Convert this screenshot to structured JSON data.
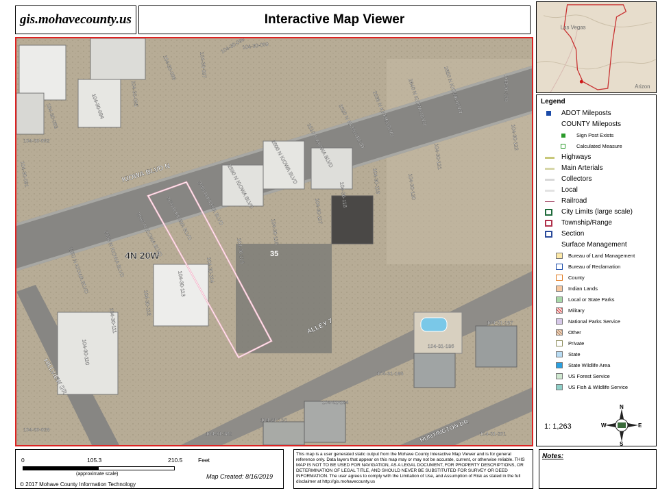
{
  "brand": "gis.mohavecounty.us",
  "title": "Interactive Map Viewer",
  "locator": {
    "labels": [
      "Las Vegas",
      "Arizon"
    ]
  },
  "legend": {
    "title": "Legend",
    "items": [
      {
        "label": "ADOT Mileposts",
        "kind": "sq",
        "color": "#1a4aa8"
      },
      {
        "label": "COUNTY Mileposts",
        "kind": "none"
      },
      {
        "label": "Sign Post Exists",
        "kind": "dot",
        "color": "#2a9a2a",
        "small": true
      },
      {
        "label": "Calculated Measure",
        "kind": "ring",
        "color": "#2a9a2a",
        "small": true
      },
      {
        "label": "Highways",
        "kind": "line",
        "color": "#c8c87a"
      },
      {
        "label": "Main Arterials",
        "kind": "line",
        "color": "#d6d6a8"
      },
      {
        "label": "Collectors",
        "kind": "line",
        "color": "#d8d8d8"
      },
      {
        "label": "Local",
        "kind": "line",
        "color": "#e2e2e2"
      },
      {
        "label": "Railroad",
        "kind": "rail",
        "color": "#a04060"
      },
      {
        "label": "City Limits (large scale)",
        "kind": "box",
        "color": "#1e6a3a"
      },
      {
        "label": "Township/Range",
        "kind": "dashbox",
        "color": "#b0304a"
      },
      {
        "label": "Section",
        "kind": "box",
        "color": "#2a4a9a"
      },
      {
        "label": "Surface Management",
        "kind": "none"
      }
    ],
    "surface": [
      {
        "label": "Bureau of Land Management",
        "color": "#fde9a8"
      },
      {
        "label": "Bureau of Reclamation",
        "color": "#ffffff",
        "border": "#1a4aa8"
      },
      {
        "label": "County",
        "color": "#ffffff",
        "border": "#e07a20"
      },
      {
        "label": "Indian Lands",
        "color": "#f7c8a0"
      },
      {
        "label": "Local or State Parks",
        "color": "#a8d8a8"
      },
      {
        "label": "Military",
        "color": "#fbe0e0",
        "hatch": "#d04040"
      },
      {
        "label": "National Parks Service",
        "color": "#d6c8e8"
      },
      {
        "label": "Other",
        "color": "#f0d8c0",
        "hatch": "#b08060"
      },
      {
        "label": "Private",
        "color": "#ffffff",
        "border": "#8a8a5a"
      },
      {
        "label": "State",
        "color": "#b8dcf4"
      },
      {
        "label": "State Wildlife Area",
        "color": "#2aa0e0"
      },
      {
        "label": "US Forest Service",
        "color": "#cfe8d0"
      },
      {
        "label": "US Fish & Wildlife Service",
        "color": "#8fd0c8"
      }
    ],
    "scale_ratio": "1: 1,263",
    "compass": {
      "n": "N",
      "e": "E",
      "s": "S",
      "w": "W"
    }
  },
  "map": {
    "streets": [
      {
        "name": "KIOWA BLVD N"
      },
      {
        "name": "ALLEY 7"
      },
      {
        "name": "HILLVIEW DR"
      },
      {
        "name": "HUNTINGTON DR"
      }
    ],
    "township": "4N 20W",
    "section": "35",
    "addresses": [
      "2550 N KIOWA BLVD",
      "2558 N KIOWA BLVD",
      "2560 N KIOWA BLVD",
      "2570 N KIOWA BLVD",
      "2580 N KIOWA BLVD",
      "2590 N KIOWA BLVD",
      "2600 N KIOWA BLVD",
      "2610 N KIOWA BLVD",
      "2620 N KIOWA BLVD",
      "2636 N KIOWA BLVD",
      "2640 N KIOWA BLVD",
      "2650 N KIOWA BLVD"
    ],
    "parcels": [
      "104-30-099",
      "104-30-097",
      "104-30-098",
      "104-30-096",
      "104-30-095",
      "104-30-094",
      "104-30-093",
      "104-30-092",
      "104-30-091",
      "104-30-124",
      "104-30-122",
      "104-30-121",
      "104-30-120",
      "104-30-119",
      "104-30-118",
      "104-30-117",
      "104-30-116",
      "104-30-115",
      "104-30-114",
      "104-30-113",
      "104-30-112",
      "104-30-111",
      "104-30-110",
      "104-30-028",
      "104-31-187",
      "104-31-186",
      "104-31-185",
      "104-31-184",
      "104-31-183",
      "104-31-182",
      "104-31-201"
    ]
  },
  "scale": {
    "ticks": [
      "0",
      "105.3",
      "210.5"
    ],
    "unit": "Feet",
    "note": "(approximate scale)"
  },
  "copyright": "© 2017 Mohave County Information Technology",
  "map_created": "Map Created: 8/16/2019",
  "disclaimer": "This map is a user generated static output from the Mohave County Interactive Map Viewer and is for general reference only. Data layers that appear on this map may or may not be accurate, current, or otherwise reliable. THIS MAP IS NOT TO BE USED FOR NAVIGATION, AS A LEGAL DOCUMENT, FOR PROPERTY DESCRIPTIONS, OR DETERMINATION OF LEGAL TITLE, AND SHOULD NEVER BE SUBSTITUTED FOR SURVEY OR DEED INFORMATION. The user agrees to comply with the Limitation of Use, and Assumption of Risk as stated in the full disclaimer at http://gis.mohavecounty.us",
  "notes_label": "Notes:"
}
